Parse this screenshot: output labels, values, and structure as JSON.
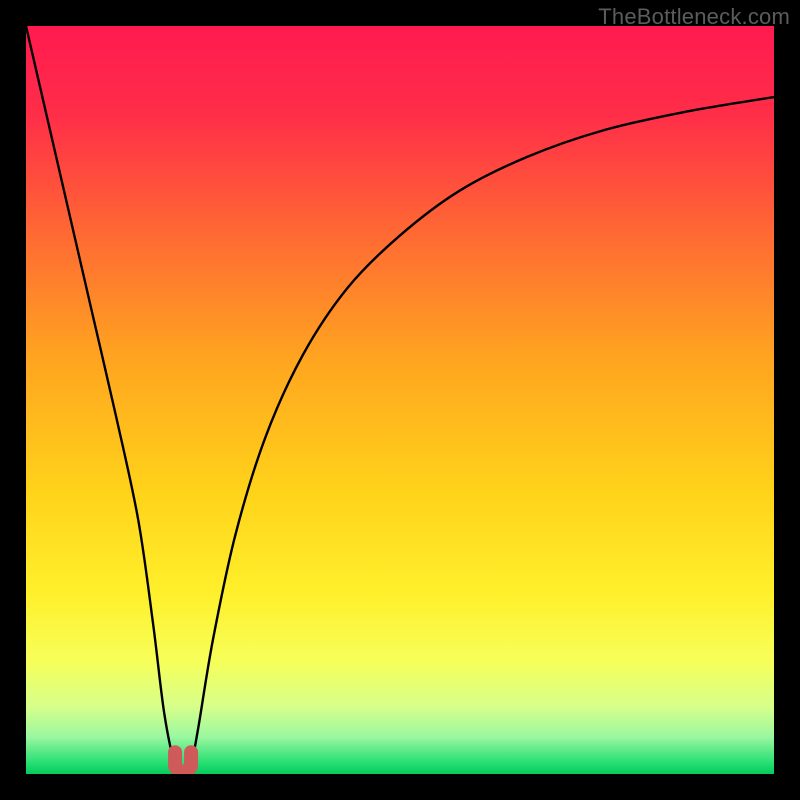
{
  "watermark": "TheBottleneck.com",
  "chart_data": {
    "type": "line",
    "title": "",
    "xlabel": "",
    "ylabel": "",
    "xlim": [
      0,
      100
    ],
    "ylim": [
      0,
      100
    ],
    "series": [
      {
        "name": "bottleneck-curve",
        "x": [
          0,
          3,
          6,
          9,
          12,
          15,
          17,
          18.5,
          20,
          21,
          22,
          23,
          25,
          28,
          32,
          37,
          43,
          50,
          58,
          67,
          77,
          88,
          100
        ],
        "values": [
          100,
          87,
          74,
          61,
          48,
          34,
          20,
          8,
          1,
          0.5,
          1,
          6,
          18,
          32,
          45,
          56,
          65,
          72,
          78,
          82.5,
          86,
          88.5,
          90.5
        ]
      }
    ],
    "marker": {
      "name": "bottleneck-minimum-marker",
      "x": 21,
      "y": 0.5,
      "color": "#cf5a5a"
    },
    "gradient_stops": [
      {
        "pos": 0.0,
        "color": "#ff1a50"
      },
      {
        "pos": 0.12,
        "color": "#ff2e48"
      },
      {
        "pos": 0.28,
        "color": "#ff6a33"
      },
      {
        "pos": 0.45,
        "color": "#ffa61f"
      },
      {
        "pos": 0.62,
        "color": "#ffd21a"
      },
      {
        "pos": 0.76,
        "color": "#fff02b"
      },
      {
        "pos": 0.85,
        "color": "#f6ff5a"
      },
      {
        "pos": 0.91,
        "color": "#d6ff8a"
      },
      {
        "pos": 0.95,
        "color": "#9cf7a0"
      },
      {
        "pos": 0.985,
        "color": "#26df73"
      },
      {
        "pos": 1.0,
        "color": "#07c95c"
      }
    ]
  }
}
